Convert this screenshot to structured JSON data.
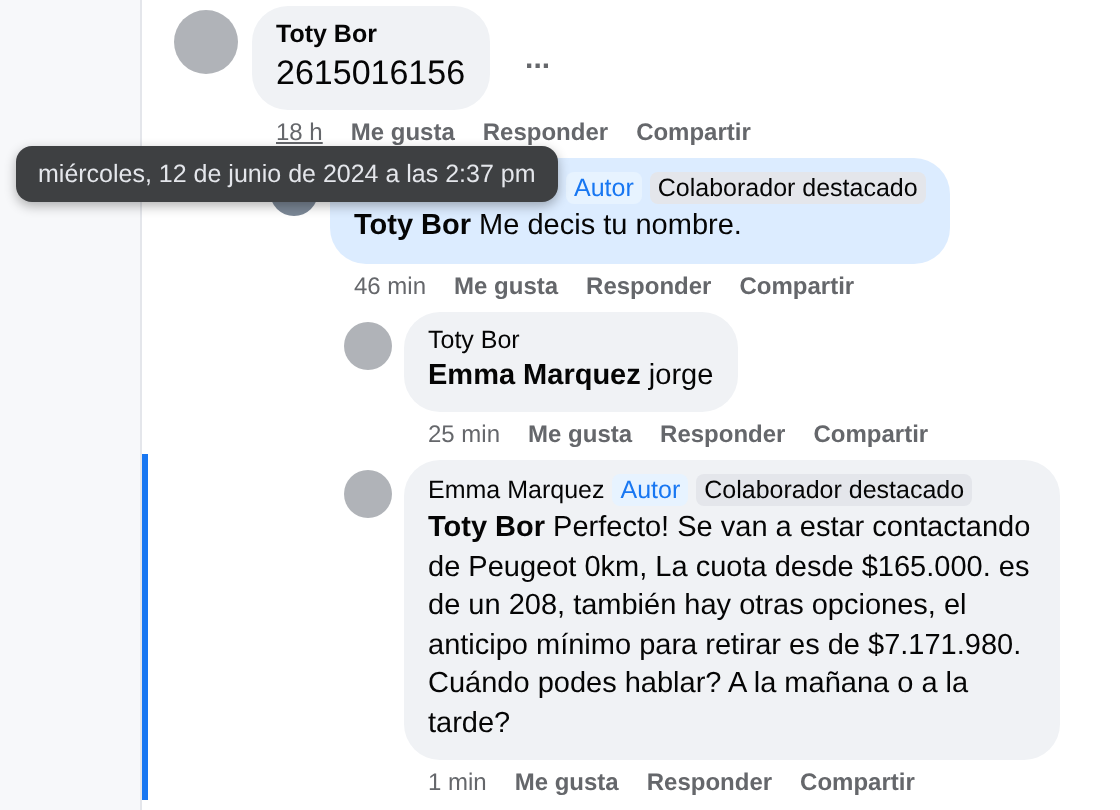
{
  "comments": [
    {
      "author": "Toty Bor",
      "text": "2615016156",
      "more": "...",
      "time": "18 h",
      "time_hovered": true,
      "highlighted": false,
      "new_marker": false,
      "actions": [
        "Me gusta",
        "Responder",
        "Compartir"
      ],
      "children": [
        {
          "text": "**Toty Bor** Me decis tu nombre.",
          "time": "46 min",
          "time_hovered": false,
          "highlighted": true,
          "new_marker": false,
          "badges": [
            {
              "label": "Autor",
              "kind": "author"
            },
            {
              "label": "Colaborador destacado",
              "kind": "contributor"
            }
          ],
          "actions": [
            "Me gusta",
            "Responder",
            "Compartir"
          ],
          "children": [
            {
              "author": "Toty Bor",
              "text": "**Emma Marquez** jorge",
              "time": "25 min",
              "time_hovered": false,
              "highlighted": false,
              "new_marker": false,
              "actions": [
                "Me gusta",
                "Responder",
                "Compartir"
              ]
            },
            {
              "author": "Emma Marquez",
              "text": "**Toty Bor** Perfecto! Se van a estar contactando de Peugeot 0km, La cuota desde $165.000. es de un 208, también hay otras opciones, el anticipo mínimo para retirar es de $7.171.980. Cuándo podes hablar? A la mañana o a la tarde?",
              "time": "1 min",
              "time_hovered": false,
              "highlighted": false,
              "new_marker": true,
              "badges": [
                {
                  "label": "Autor",
                  "kind": "author"
                },
                {
                  "label": "Colaborador destacado",
                  "kind": "contributor"
                }
              ],
              "actions": [
                "Me gusta",
                "Responder",
                "Compartir"
              ]
            }
          ]
        }
      ]
    }
  ],
  "tooltip": {
    "text": "miércoles, 12 de junio de 2024 a las 2:37 pm"
  }
}
